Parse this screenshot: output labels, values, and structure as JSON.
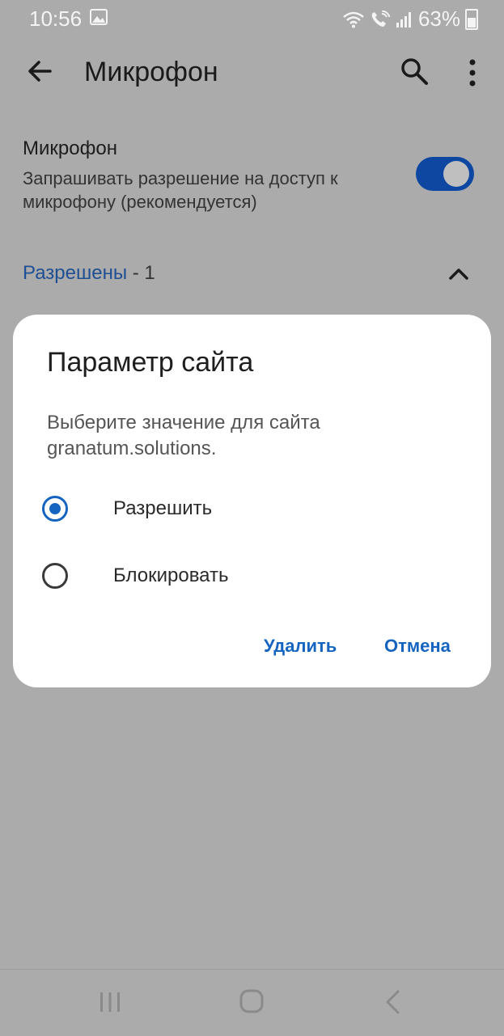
{
  "status_bar": {
    "time": "10:56",
    "battery": "63%",
    "icons": [
      "gallery-icon",
      "wifi-icon",
      "wifi-calling-icon",
      "signal-icon",
      "battery-icon"
    ]
  },
  "app_bar": {
    "title": "Микрофон",
    "icons": [
      "back-arrow-icon",
      "search-icon",
      "more-vert-icon"
    ]
  },
  "microphone_setting": {
    "title": "Микрофон",
    "description": "Запрашивать разрешение на доступ к микрофону (рекомендуется)",
    "enabled": true
  },
  "allowed_section": {
    "label": "Разрешены",
    "count": " - 1"
  },
  "dialog": {
    "title": "Параметр сайта",
    "message": "Выберите значение для сайта granatum.solutions.",
    "options": [
      {
        "label": "Разрешить",
        "selected": true
      },
      {
        "label": "Блокировать",
        "selected": false
      }
    ],
    "buttons": {
      "delete": "Удалить",
      "cancel": "Отмена"
    }
  },
  "colors": {
    "accent": "#1565c0",
    "toggle": "#0d47a1",
    "scrim_background": "#ababab"
  }
}
